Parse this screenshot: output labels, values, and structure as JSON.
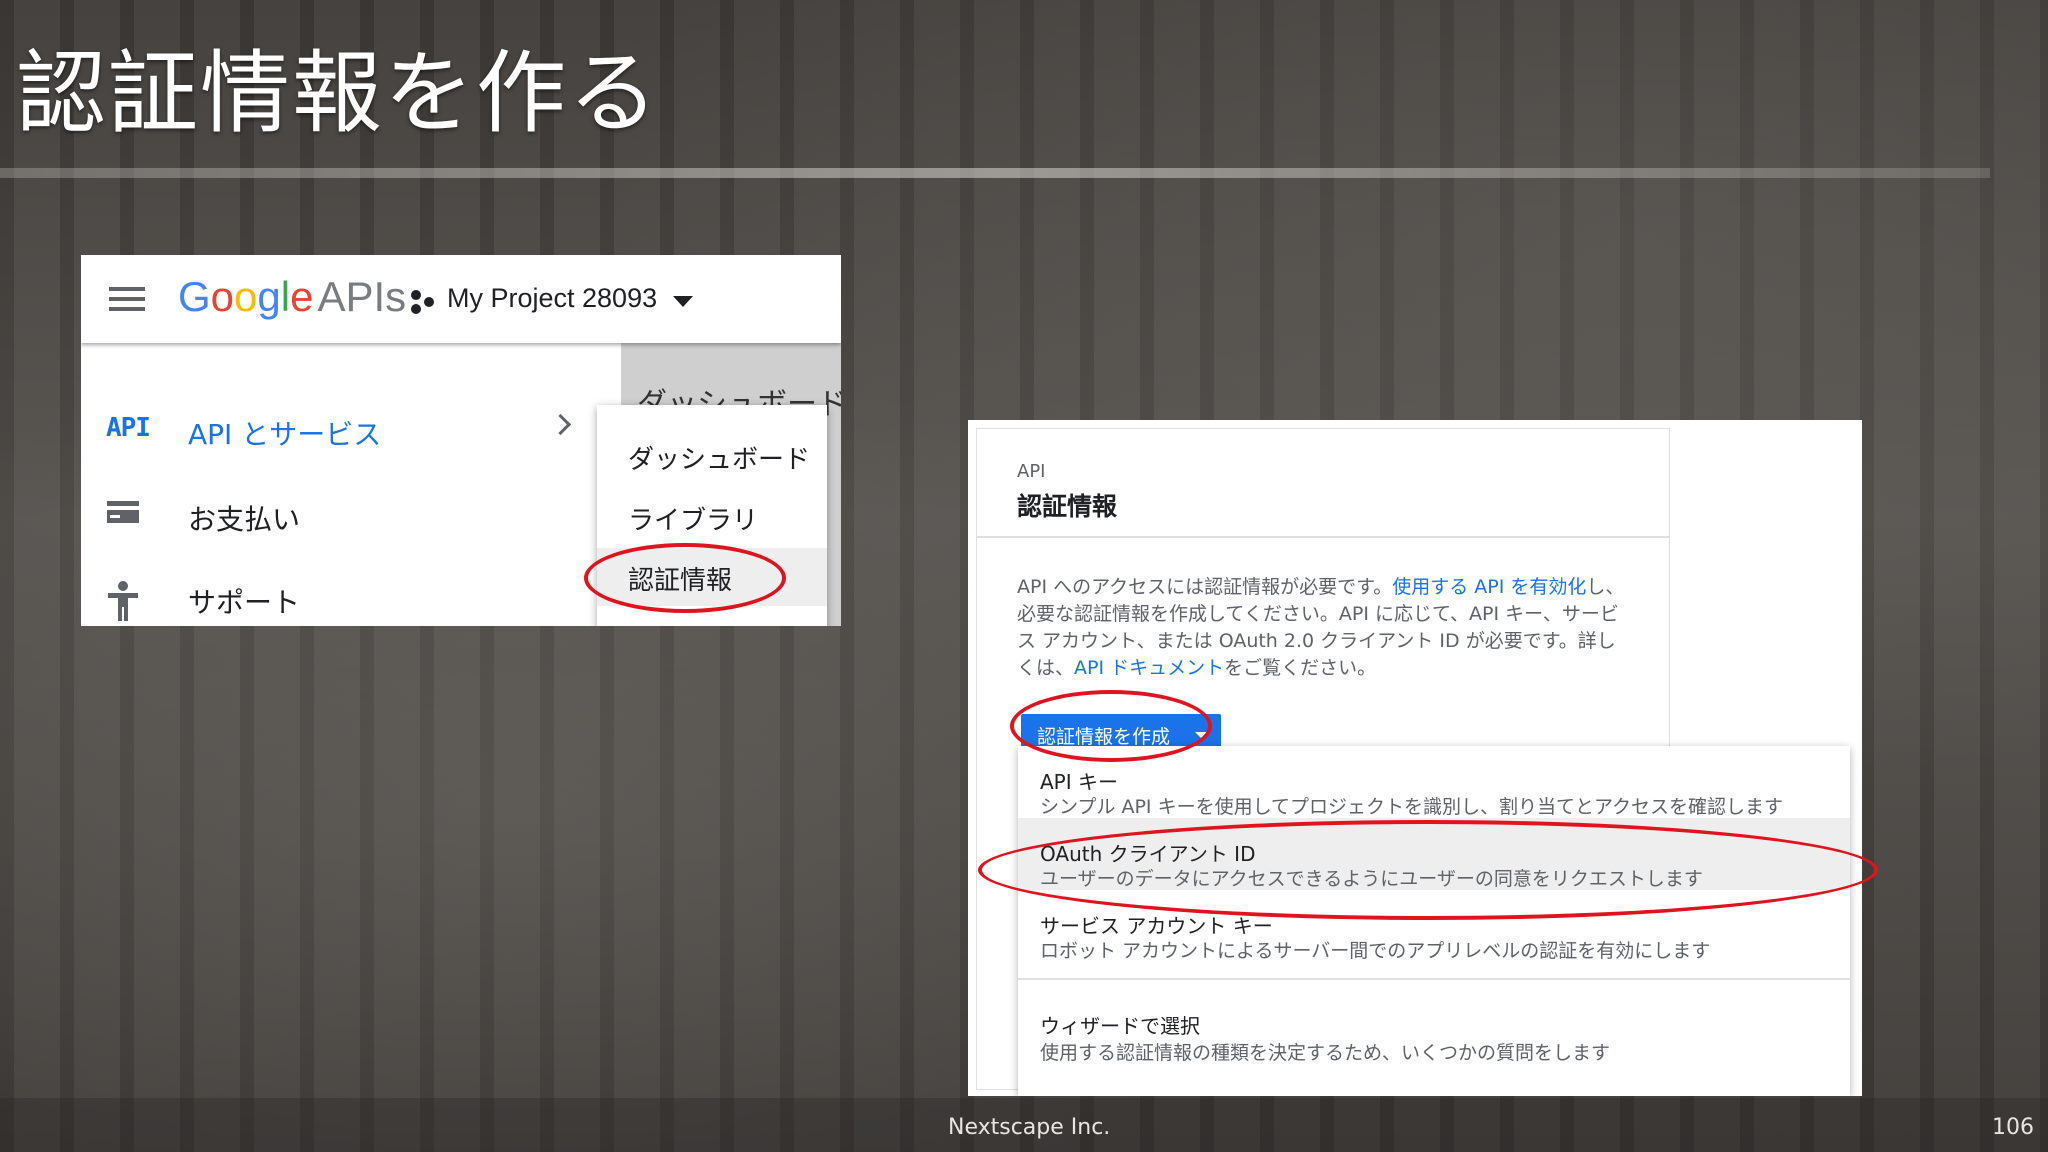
{
  "slide": {
    "title": "認証情報を作る",
    "company": "Nextscape Inc.",
    "page_number": "106"
  },
  "console_header": {
    "google_label": "Google",
    "apis_label": "APIs",
    "project_name": "My Project 28093"
  },
  "background_page": {
    "title_fragment": "ダッシュボード"
  },
  "nav": {
    "api_badge": "API",
    "items": [
      {
        "label": "API とサービス"
      },
      {
        "label": "お支払い"
      },
      {
        "label": "サポート"
      }
    ]
  },
  "submenu": {
    "items": [
      {
        "label": "ダッシュボード"
      },
      {
        "label": "ライブラリ"
      },
      {
        "label": "認証情報"
      }
    ]
  },
  "credentials": {
    "breadcrumb": "API",
    "title": "認証情報",
    "desc_part1": "API へのアクセスには認証情報が必要です。",
    "desc_link1": "使用する API を有効化",
    "desc_part2": "し、必要な認証情報を作成してください。API に応じて、API キー、サービス アカウント、または OAuth 2.0 クライアント ID が必要です。詳しくは、",
    "desc_link2": "API ドキュメント",
    "desc_part3": "をご覧ください。",
    "create_button": "認証情報を作成"
  },
  "dropdown": {
    "items": [
      {
        "title": "API キー",
        "desc": "シンプル API キーを使用してプロジェクトを識別し、割り当てとアクセスを確認します"
      },
      {
        "title": "OAuth クライアント ID",
        "desc": "ユーザーのデータにアクセスできるようにユーザーの同意をリクエストします"
      },
      {
        "title": "サービス アカウント キー",
        "desc": "ロボット アカウントによるサーバー間でのアプリレベルの認証を有効にします"
      },
      {
        "title": "ウィザードで選択",
        "desc": "使用する認証情報の種類を決定するため、いくつかの質問をします"
      }
    ]
  },
  "colors": {
    "accent_blue": "#1a73e8",
    "annotation_red": "#e0141e"
  }
}
